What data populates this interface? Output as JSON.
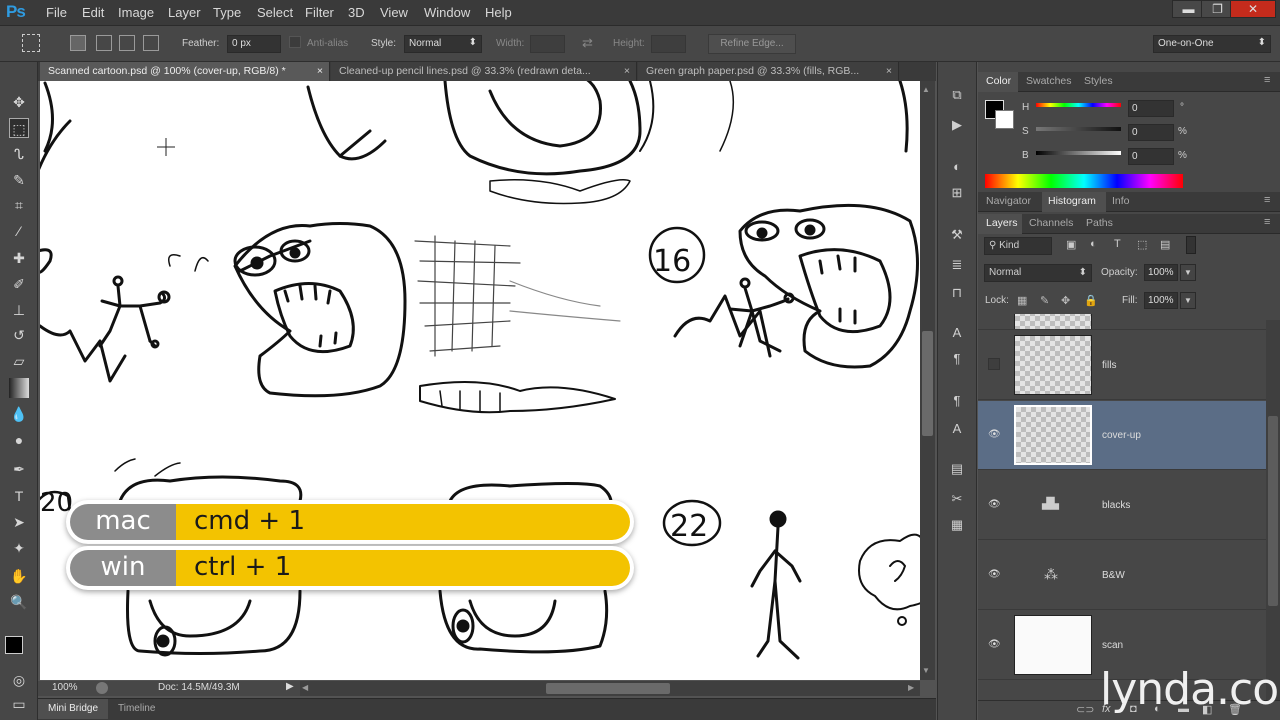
{
  "app": {
    "logo": "Ps"
  },
  "menu": [
    "File",
    "Edit",
    "Image",
    "Layer",
    "Type",
    "Select",
    "Filter",
    "3D",
    "View",
    "Window",
    "Help"
  ],
  "window_controls": {
    "minimize": "▬",
    "restore": "❐",
    "close": "✕"
  },
  "options": {
    "feather_label": "Feather:",
    "feather_value": "0 px",
    "antialias_label": "Anti-alias",
    "style_label": "Style:",
    "style_value": "Normal",
    "width_label": "Width:",
    "height_label": "Height:",
    "refine_edge": "Refine Edge...",
    "workspace": "One-on-One"
  },
  "tabs": [
    {
      "label": "Scanned cartoon.psd @ 100% (cover-up, RGB/8) *",
      "close": "×",
      "active": true
    },
    {
      "label": "Cleaned-up pencil lines.psd @ 33.3% (redrawn deta...",
      "close": "×",
      "active": false
    },
    {
      "label": "Green graph paper.psd @ 33.3% (fills, RGB...",
      "close": "×",
      "active": false
    }
  ],
  "status": {
    "zoom": "100%",
    "doc": "Doc: 14.5M/49.3M"
  },
  "bottom_tabs": [
    "Mini Bridge",
    "Timeline"
  ],
  "color_panel": {
    "tabs": [
      "Color",
      "Swatches",
      "Styles"
    ],
    "h_label": "H",
    "s_label": "S",
    "b_label": "B",
    "h_value": "0",
    "s_value": "0",
    "b_value": "0",
    "h_unit": "°",
    "s_unit": "%",
    "b_unit": "%"
  },
  "navigator_panel": {
    "tabs": [
      "Navigator",
      "Histogram",
      "Info"
    ]
  },
  "layers_panel": {
    "tabs": [
      "Layers",
      "Channels",
      "Paths"
    ],
    "filter_kind": "Kind",
    "blend_mode": "Normal",
    "opacity_label": "Opacity:",
    "opacity_value": "100%",
    "lock_label": "Lock:",
    "fill_label": "Fill:",
    "fill_value": "100%",
    "layers": [
      {
        "name": "fills",
        "visible": false,
        "selected": false
      },
      {
        "name": "cover-up",
        "visible": true,
        "selected": true
      },
      {
        "name": "blacks",
        "visible": true,
        "selected": false
      },
      {
        "name": "B&W",
        "visible": true,
        "selected": false
      },
      {
        "name": "scan",
        "visible": true,
        "selected": false
      }
    ]
  },
  "overlay": {
    "mac_label": "mac",
    "mac_keys": "cmd + 1",
    "win_label": "win",
    "win_keys": "ctrl + 1"
  },
  "sketch": {
    "number_16": "16",
    "number_22": "22",
    "number_20": "20"
  },
  "watermark": "lynda.com",
  "colors": {
    "accent_yellow": "#f3c300",
    "os_gray": "#8c8c8c",
    "selected_layer": "#5b6d86",
    "ps_blue": "#2f9be0"
  }
}
